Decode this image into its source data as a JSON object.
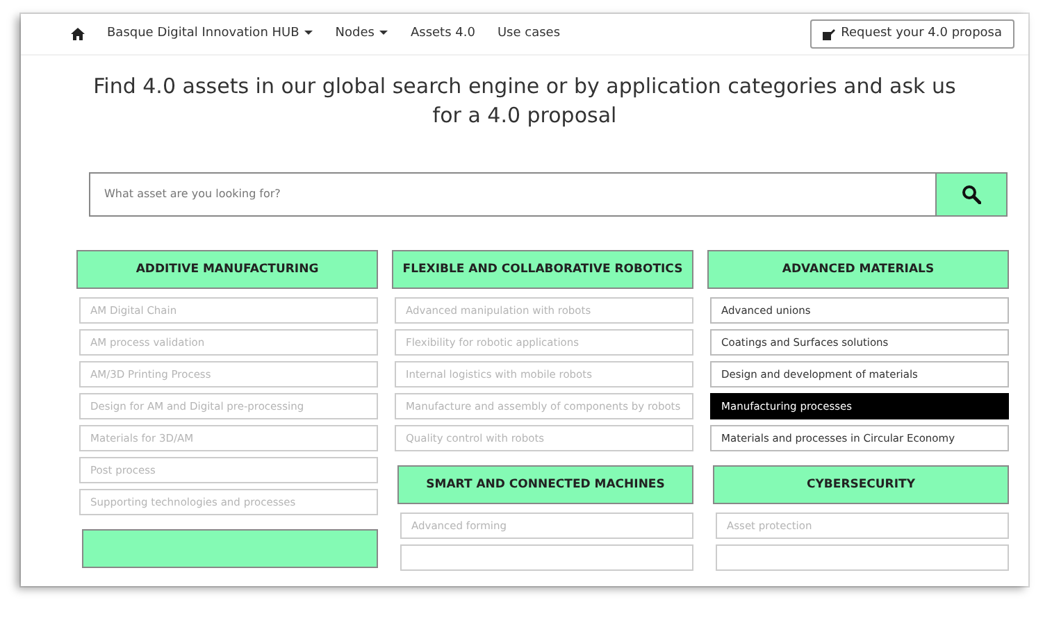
{
  "nav": {
    "items": [
      {
        "label": "Basque Digital Innovation HUB",
        "dropdown": true
      },
      {
        "label": "Nodes",
        "dropdown": true
      },
      {
        "label": "Assets 4.0",
        "dropdown": false
      },
      {
        "label": "Use cases",
        "dropdown": false
      }
    ],
    "cta": "Request your 4.0 proposa"
  },
  "headline": "Find 4.0 assets in our global search engine or by application categories and ask us for a 4.0 proposal",
  "search": {
    "placeholder": "What asset are you looking for?"
  },
  "columns": [
    {
      "categories": [
        {
          "title": "ADDITIVE MANUFACTURING",
          "items": [
            {
              "label": "AM Digital Chain",
              "disabled": true,
              "selected": false
            },
            {
              "label": "AM process validation",
              "disabled": true,
              "selected": false
            },
            {
              "label": "AM/3D Printing Process",
              "disabled": true,
              "selected": false
            },
            {
              "label": "Design for AM and Digital pre-processing",
              "disabled": true,
              "selected": false
            },
            {
              "label": "Materials for 3D/AM",
              "disabled": true,
              "selected": false
            },
            {
              "label": "Post process",
              "disabled": true,
              "selected": false
            },
            {
              "label": "Supporting technologies and processes",
              "disabled": true,
              "selected": false
            }
          ]
        },
        {
          "kind": "cut"
        }
      ]
    },
    {
      "categories": [
        {
          "title": "FLEXIBLE AND COLLABORATIVE ROBOTICS",
          "items": [
            {
              "label": "Advanced manipulation with robots",
              "disabled": true,
              "selected": false
            },
            {
              "label": "Flexibility for robotic applications",
              "disabled": true,
              "selected": false
            },
            {
              "label": "Internal logistics with mobile robots",
              "disabled": true,
              "selected": false
            },
            {
              "label": "Manufacture and assembly of components by robots",
              "disabled": true,
              "selected": false
            },
            {
              "label": "Quality control with robots",
              "disabled": true,
              "selected": false
            }
          ]
        },
        {
          "title": "SMART AND CONNECTED MACHINES",
          "items": [
            {
              "label": "Advanced forming",
              "disabled": true,
              "selected": false
            },
            {
              "disabled": true,
              "selected": false
            }
          ]
        }
      ]
    },
    {
      "categories": [
        {
          "title": "ADVANCED MATERIALS",
          "items": [
            {
              "label": "Advanced unions",
              "disabled": false,
              "selected": false
            },
            {
              "label": "Coatings and Surfaces solutions",
              "disabled": false,
              "selected": false
            },
            {
              "label": "Design and development of materials",
              "disabled": false,
              "selected": false
            },
            {
              "label": "Manufacturing processes",
              "disabled": false,
              "selected": true
            },
            {
              "label": "Materials and processes in Circular Economy",
              "disabled": false,
              "selected": false
            }
          ]
        },
        {
          "title": "CYBERSECURITY",
          "items": [
            {
              "label": "Asset protection",
              "disabled": true,
              "selected": false
            },
            {
              "disabled": true,
              "selected": false
            }
          ]
        }
      ]
    }
  ]
}
